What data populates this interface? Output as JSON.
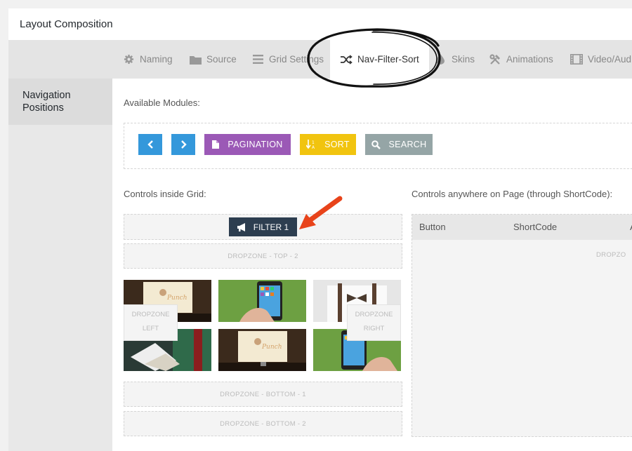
{
  "panel": {
    "title": "Layout Composition"
  },
  "tabs": [
    {
      "label": "Naming",
      "icon": "gear-icon"
    },
    {
      "label": "Source",
      "icon": "folder-icon"
    },
    {
      "label": "Grid Settings",
      "icon": "list-icon"
    },
    {
      "label": "Nav-Filter-Sort",
      "icon": "shuffle-icon",
      "active": true
    },
    {
      "label": "Skins",
      "icon": "drop-icon"
    },
    {
      "label": "Animations",
      "icon": "tools-icon"
    },
    {
      "label": "Video/Aud",
      "icon": "film-icon"
    }
  ],
  "sidebar": {
    "items": [
      {
        "label": "Navigation Positions"
      }
    ]
  },
  "available_modules": {
    "label": "Available Modules:",
    "buttons": [
      {
        "label": "",
        "icon": "chevron-left-icon",
        "color": "#3498db"
      },
      {
        "label": "",
        "icon": "chevron-right-icon",
        "color": "#3498db"
      },
      {
        "label": "PAGINATION",
        "icon": "document-icon",
        "color": "#9b59b6"
      },
      {
        "label": "SORT",
        "icon": "sort-icon",
        "color": "#f1c40f"
      },
      {
        "label": "SEARCH",
        "icon": "search-icon",
        "color": "#95a5a6"
      }
    ]
  },
  "controls_inside": {
    "label": "Controls inside Grid:",
    "filter_button": {
      "label": "FILTER 1",
      "icon": "megaphone-icon",
      "color": "#2d3e50"
    },
    "dropzones": {
      "top2": "DROPZONE - TOP - 2",
      "left": [
        "DROPZONE",
        "LEFT"
      ],
      "right": [
        "DROPZONE",
        "RIGHT"
      ],
      "bottom1": "DROPZONE - BOTTOM - 1",
      "bottom2": "DROPZONE - BOTTOM - 2"
    }
  },
  "controls_anywhere": {
    "label": "Controls anywhere on Page (through ShortCode):",
    "columns": [
      "Button",
      "ShortCode",
      "A"
    ],
    "dropzone": "DROPZO"
  },
  "annotation": {
    "color": "#e8431a"
  }
}
